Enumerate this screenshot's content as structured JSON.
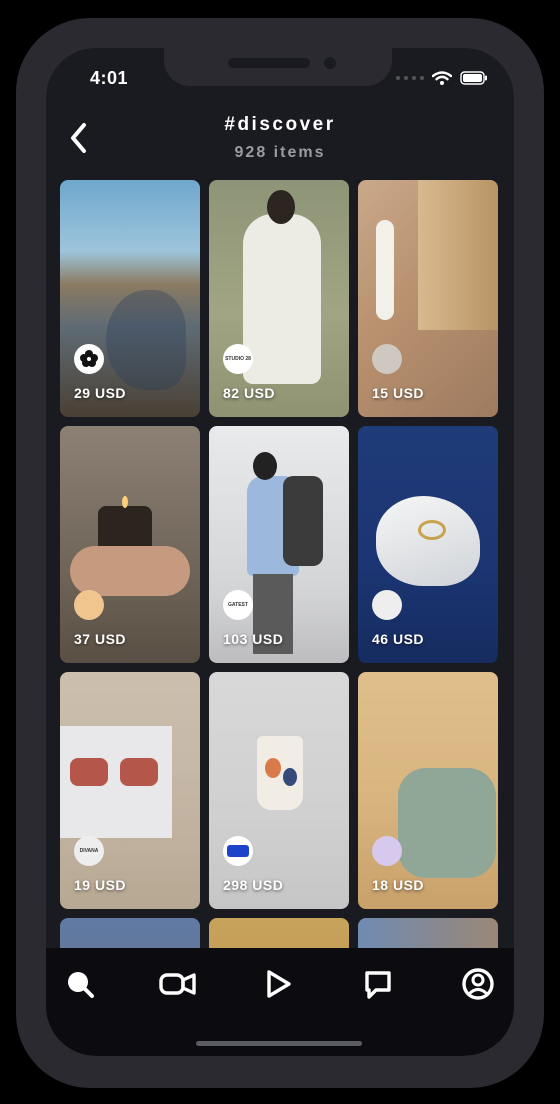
{
  "status_bar": {
    "time": "4:01"
  },
  "header": {
    "title": "#discover",
    "subtitle": "928 items"
  },
  "products": [
    {
      "price": "29 USD"
    },
    {
      "price": "82 USD",
      "badge": "STUDIO 28"
    },
    {
      "price": "15 USD"
    },
    {
      "price": "37 USD"
    },
    {
      "price": "103 USD",
      "badge": "GATEST"
    },
    {
      "price": "46 USD"
    },
    {
      "price": "19 USD",
      "badge": "DIVANA"
    },
    {
      "price": "298 USD"
    },
    {
      "price": "18 USD"
    }
  ],
  "bottom_nav": {
    "items": [
      "search-icon",
      "video-camera-icon",
      "play-icon",
      "chat-icon",
      "profile-icon"
    ]
  }
}
